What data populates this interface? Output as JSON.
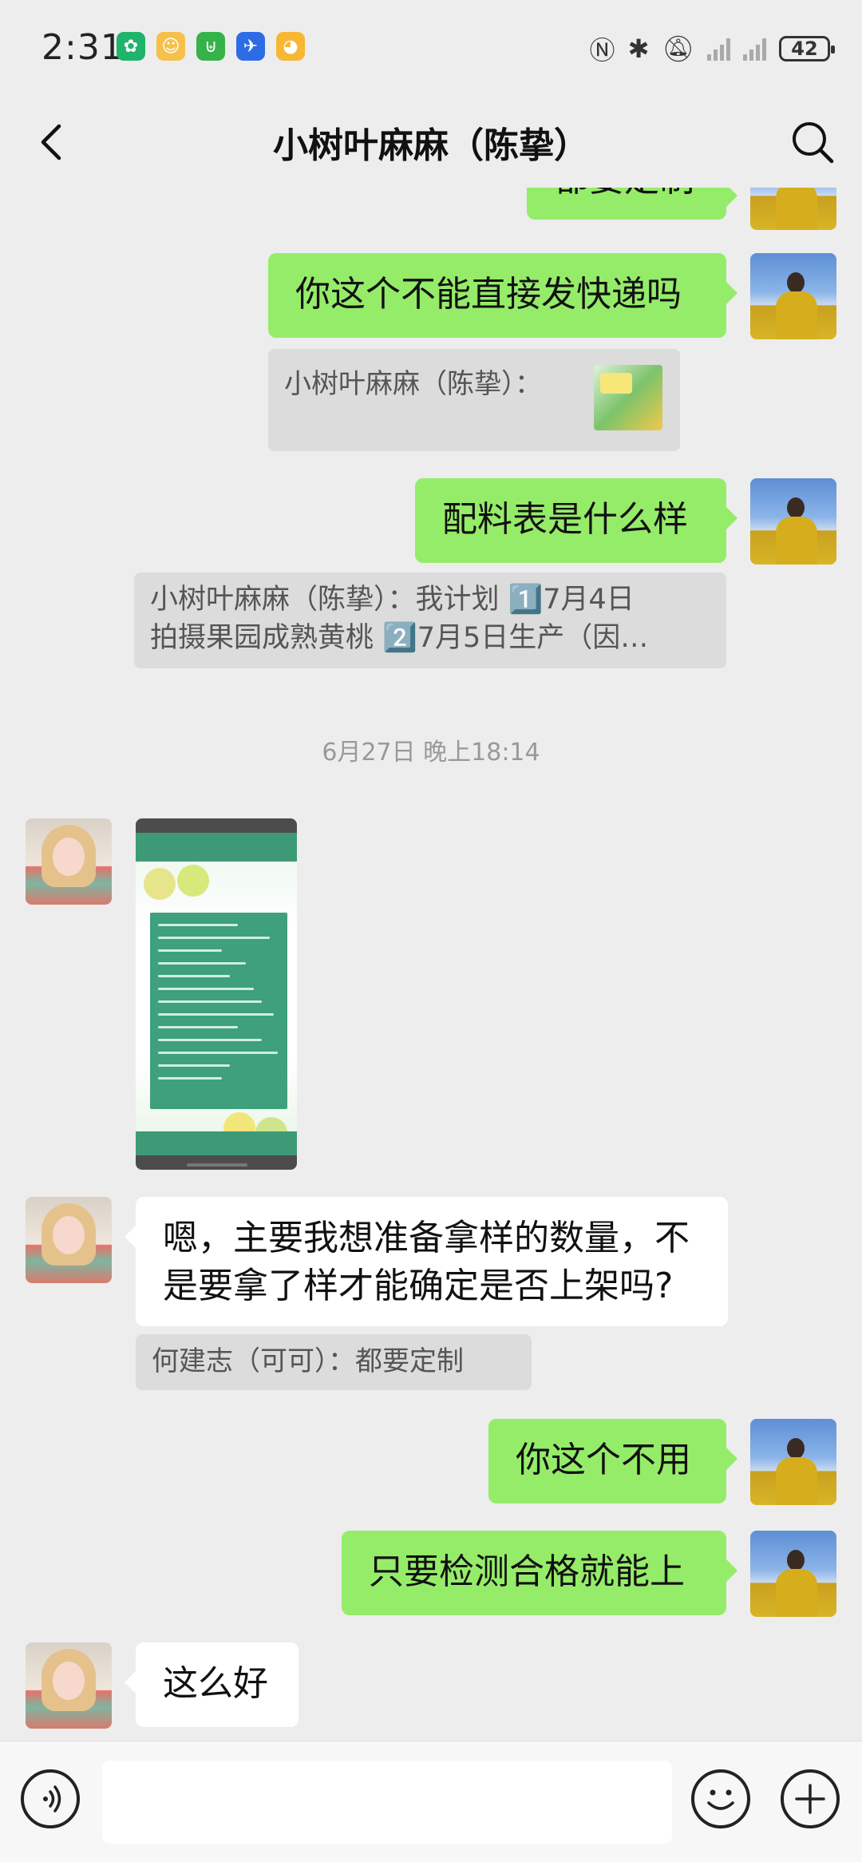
{
  "status_bar": {
    "time": "2:31",
    "battery": "42",
    "app_icons": [
      "leaf-app-icon",
      "doll-app-icon",
      "shop-app-icon",
      "plane-app-icon",
      "duck-app-icon"
    ]
  },
  "header": {
    "title": "小树叶麻麻（陈挚）"
  },
  "messages": {
    "partial_top": "都要定制",
    "m1": "你这个不能直接发快递吗",
    "q1": "小树叶麻麻（陈挚）：",
    "m2": "配料表是什么样",
    "q2_line1": "小树叶麻麻（陈挚）：我计划 1️⃣7月4日",
    "q2_line2": "拍摄果园成熟黄桃 2️⃣7月5日生产（因…",
    "timestamp": "6月27日 晚上18:14",
    "m3_line1": "嗯，主要我想准备拿样的数量，不",
    "m3_line2": "是要拿了样才能确定是否上架吗?",
    "q3": "何建志（可可）：都要定制",
    "m4": "你这个不用",
    "m5": "只要检测合格就能上",
    "m6": "这么好"
  },
  "colors": {
    "sent_bubble": "#95ec69",
    "received_bubble": "#ffffff",
    "background": "#ededed"
  }
}
